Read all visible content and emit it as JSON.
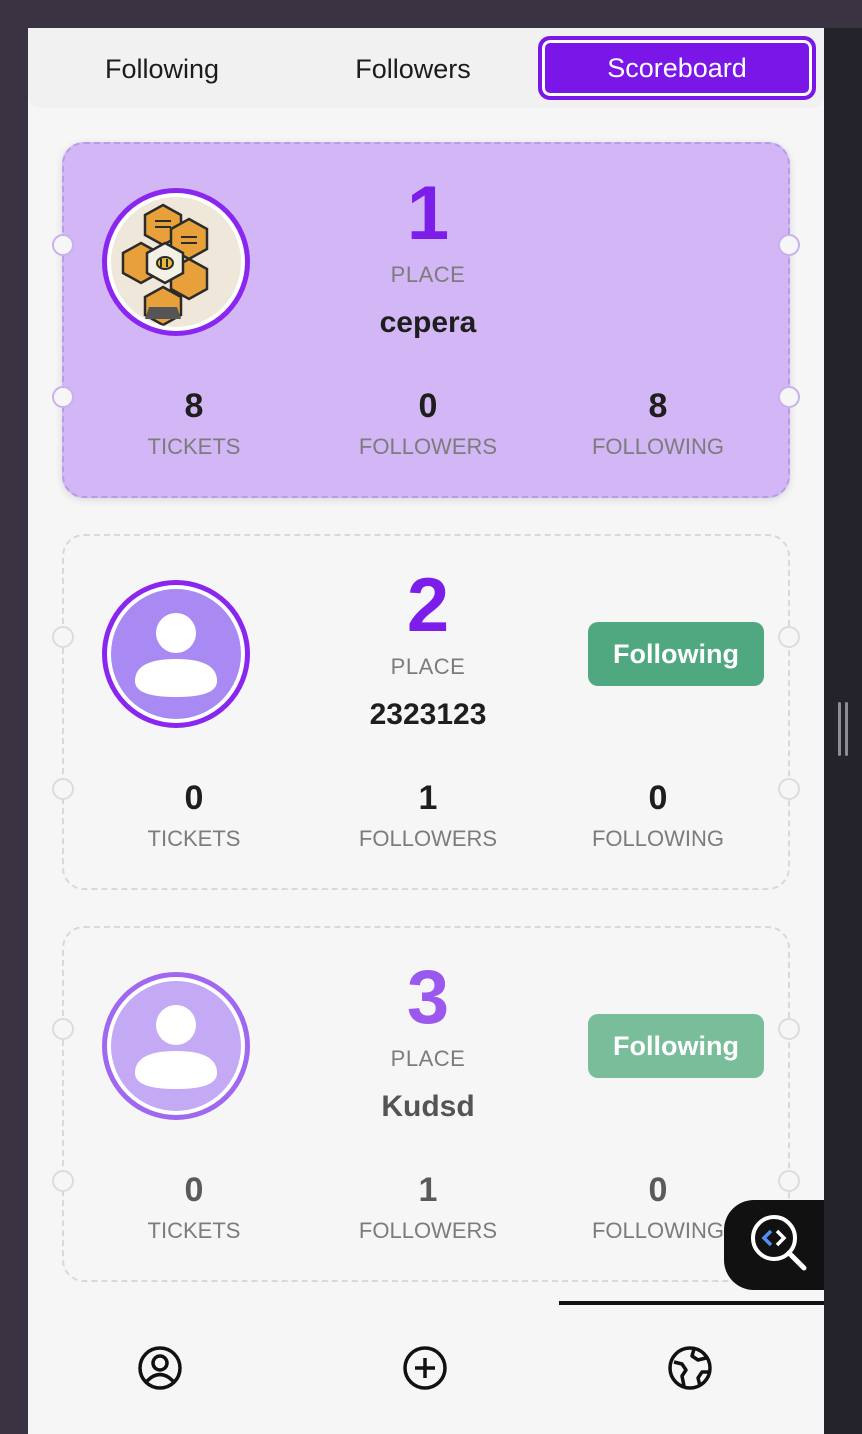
{
  "tabs": [
    {
      "label": "Following",
      "active": false
    },
    {
      "label": "Followers",
      "active": false
    },
    {
      "label": "Scoreboard",
      "active": true
    }
  ],
  "scoreboard": [
    {
      "rank": "1",
      "place_label": "PLACE",
      "username": "cepera",
      "avatar": "logo-honeycomb",
      "stats": [
        {
          "value": "8",
          "label": "TICKETS"
        },
        {
          "value": "0",
          "label": "FOLLOWERS"
        },
        {
          "value": "8",
          "label": "FOLLOWING"
        }
      ]
    },
    {
      "rank": "2",
      "place_label": "PLACE",
      "username": "2323123",
      "avatar": "user-icon",
      "follow_button": "Following",
      "stats": [
        {
          "value": "0",
          "label": "TICKETS"
        },
        {
          "value": "1",
          "label": "FOLLOWERS"
        },
        {
          "value": "0",
          "label": "FOLLOWING"
        }
      ]
    },
    {
      "rank": "3",
      "place_label": "PLACE",
      "username": "Kudsd",
      "avatar": "user-icon",
      "follow_button": "Following",
      "stats": [
        {
          "value": "0",
          "label": "TICKETS"
        },
        {
          "value": "1",
          "label": "FOLLOWERS"
        },
        {
          "value": "0",
          "label": "FOLLOWING"
        }
      ]
    }
  ],
  "colors": {
    "accent": "#7a17e8",
    "card_highlight": "#d2b6f5",
    "follow_green": "#4fa880"
  },
  "bottom_nav": [
    {
      "icon": "profile-icon"
    },
    {
      "icon": "add-circle-icon"
    },
    {
      "icon": "globe-icon",
      "active": true
    }
  ],
  "floating_button": {
    "icon": "code-search-icon"
  }
}
